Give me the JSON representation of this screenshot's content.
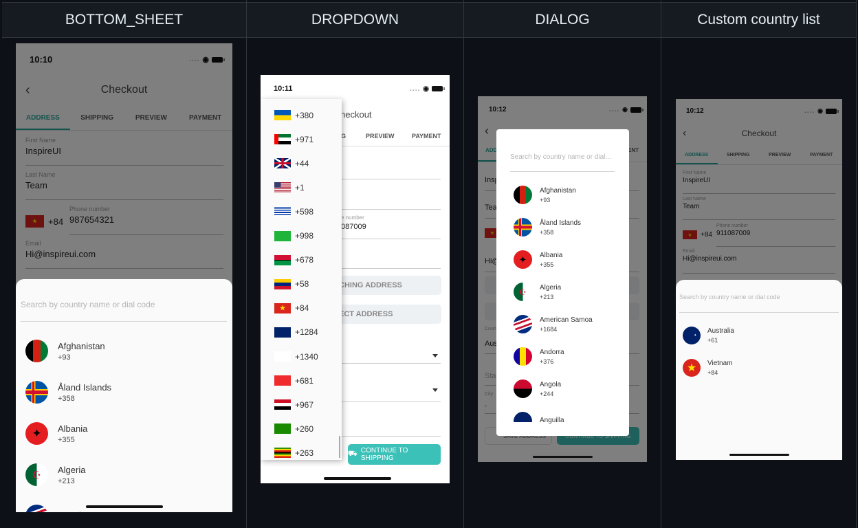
{
  "columns": [
    {
      "title": "BOTTOM_SHEET"
    },
    {
      "title": "DROPDOWN"
    },
    {
      "title": "DIALOG"
    },
    {
      "title": "Custom country list"
    }
  ],
  "common": {
    "page_title": "Checkout",
    "tabs": [
      "ADDRESS",
      "SHIPPING",
      "PREVIEW",
      "PAYMENT"
    ],
    "first_name_label": "First Name",
    "first_name": "InspireUI",
    "last_name_label": "Last Name",
    "last_name": "Team",
    "phone_label": "Phone number",
    "dial_code": "+84",
    "email_label": "Email",
    "email": "Hi@inspireui.com",
    "search_placeholder": "Search by country name or dial code",
    "search_placeholder_short": "Search by country name or dial...",
    "country_label": "Country",
    "country_value": "Aus",
    "state_label": "Sta",
    "city_label": "City",
    "city_value": "-",
    "save_address": "SAVE ADDRESS",
    "continue_shipping": "CONTINUE TO SHIPPING",
    "searching_address": "CHING ADDRESS",
    "select_address": "ECT ADDRESS",
    "heckout_fragment": "heckout",
    "tab_fragment": "G",
    "phone_fragment": "087009",
    "phone_label_fragment": "e number",
    "back_icon": "chevron-left-icon"
  },
  "bottom_sheet": {
    "time": "10:10",
    "phone": "987654321",
    "countries": [
      {
        "name": "Afghanistan",
        "code": "+93",
        "flag": "af"
      },
      {
        "name": "Åland Islands",
        "code": "+358",
        "flag": "ax"
      },
      {
        "name": "Albania",
        "code": "+355",
        "flag": "al"
      },
      {
        "name": "Algeria",
        "code": "+213",
        "flag": "dz"
      },
      {
        "name": "American Samoa",
        "code": "",
        "flag": "as"
      }
    ]
  },
  "dropdown": {
    "time": "10:11",
    "items": [
      {
        "code": "+380",
        "flag": "ua"
      },
      {
        "code": "+971",
        "flag": "ae"
      },
      {
        "code": "+44",
        "flag": "gb"
      },
      {
        "code": "+1",
        "flag": "us"
      },
      {
        "code": "+598",
        "flag": "uy"
      },
      {
        "code": "+998",
        "flag": "uz"
      },
      {
        "code": "+678",
        "flag": "vu"
      },
      {
        "code": "+58",
        "flag": "ve"
      },
      {
        "code": "+84",
        "flag": "vn"
      },
      {
        "code": "+1284",
        "flag": "vg"
      },
      {
        "code": "+1340",
        "flag": "vi"
      },
      {
        "code": "+681",
        "flag": "wf"
      },
      {
        "code": "+967",
        "flag": "ye"
      },
      {
        "code": "+260",
        "flag": "zm"
      },
      {
        "code": "+263",
        "flag": "zw"
      }
    ]
  },
  "dialog": {
    "time": "10:12",
    "countries": [
      {
        "name": "Afghanistan",
        "code": "+93",
        "flag": "af"
      },
      {
        "name": "Åland Islands",
        "code": "+358",
        "flag": "ax"
      },
      {
        "name": "Albania",
        "code": "+355",
        "flag": "al"
      },
      {
        "name": "Algeria",
        "code": "+213",
        "flag": "dz"
      },
      {
        "name": "American Samoa",
        "code": "+1684",
        "flag": "as"
      },
      {
        "name": "Andorra",
        "code": "+376",
        "flag": "ad"
      },
      {
        "name": "Angola",
        "code": "+244",
        "flag": "ao"
      },
      {
        "name": "Anguilla",
        "code": "",
        "flag": "ai"
      }
    ]
  },
  "custom": {
    "time": "10:12",
    "phone": "911087009",
    "countries": [
      {
        "name": "Australia",
        "code": "+61",
        "flag": "au"
      },
      {
        "name": "Vietnam",
        "code": "+84",
        "flag": "vn"
      }
    ]
  },
  "colors": {
    "accent": "#26a69a",
    "button_teal": "#3cc1b8",
    "background": "#0d1117",
    "header": "#161b22"
  }
}
